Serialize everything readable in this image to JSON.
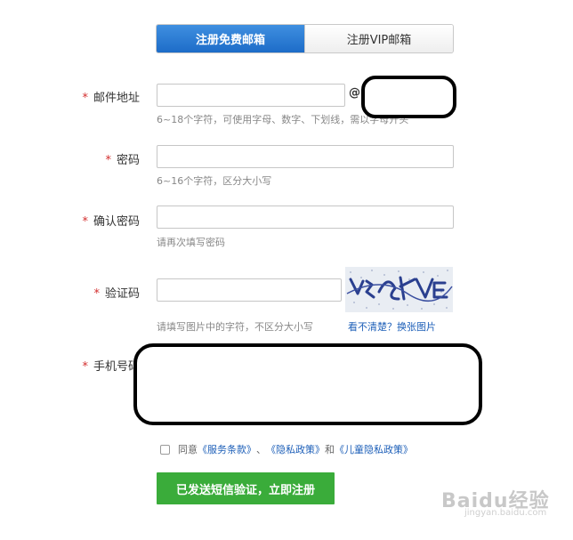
{
  "tabs": {
    "free": "注册免费邮箱",
    "vip": "注册VIP邮箱"
  },
  "required_mark": "*",
  "email": {
    "label": "邮件地址",
    "at": "@",
    "hint": "6~18个字符，可使用字母、数字、下划线，需以字母开头"
  },
  "password": {
    "label": "密码",
    "hint": "6~16个字符，区分大小写"
  },
  "confirm": {
    "label": "确认密码",
    "hint": "请再次填写密码"
  },
  "captcha": {
    "label": "验证码",
    "hint": "请填写图片中的字符，不区分大小写",
    "refresh": "看不清楚？换张图片"
  },
  "phone": {
    "label": "手机号码"
  },
  "agreement": {
    "prefix": "同意",
    "terms": "《服务条款》",
    "sep": "、",
    "privacy": "《隐私政策》",
    "and": "和",
    "child": "《儿童隐私政策》"
  },
  "submit": "已发送短信验证，立即注册",
  "watermark": {
    "logo": "Baidu经验",
    "url": "jingyan.baidu.com"
  }
}
